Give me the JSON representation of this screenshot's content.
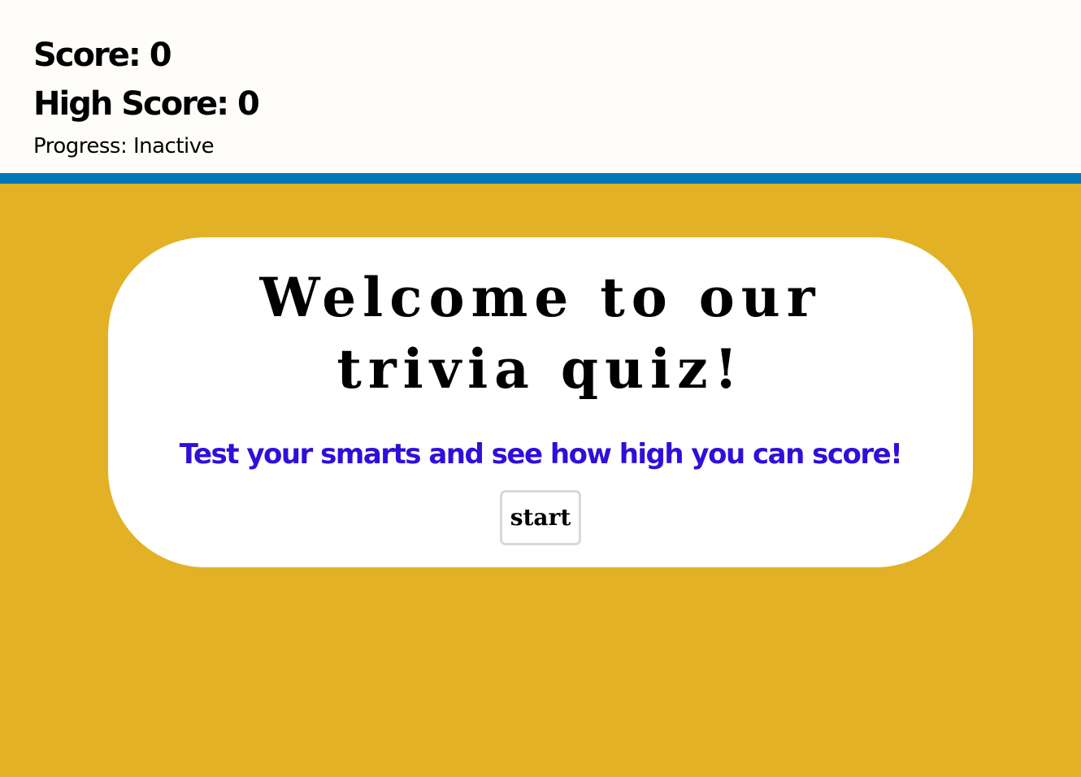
{
  "header": {
    "score_label": "Score: 0",
    "high_score_label": "High Score: 0",
    "progress_label": "Progress: Inactive"
  },
  "welcome": {
    "title_line1": "Welcome to our",
    "title_line2": "trivia quiz!",
    "subtitle": "Test your smarts and see how high you can score!",
    "start_label": "start"
  },
  "colors": {
    "header_bg": "#fffdf9",
    "accent_bar": "#0077b6",
    "page_bg": "#e2b125",
    "card_bg": "#ffffff",
    "subtitle_text": "#2f0fd9"
  }
}
